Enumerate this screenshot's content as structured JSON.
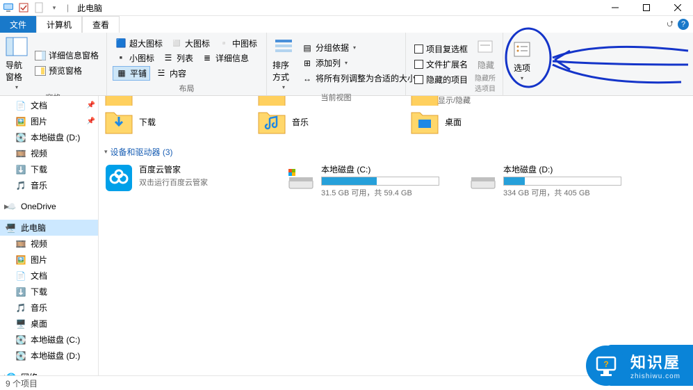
{
  "window": {
    "title": "此电脑",
    "separator": "|"
  },
  "ribbon_tabs": {
    "file": "文件",
    "computer": "计算机",
    "view": "查看"
  },
  "ribbon": {
    "panes": {
      "nav_pane": "导航窗格",
      "detail_pane": "详细信息窗格",
      "preview_pane": "预览窗格",
      "group_label": "窗格"
    },
    "layout": {
      "xl_icons": "超大图标",
      "l_icons": "大图标",
      "m_icons": "中图标",
      "s_icons": "小图标",
      "list": "列表",
      "details": "详细信息",
      "tiles": "平铺",
      "content": "内容",
      "group_label": "布局"
    },
    "current_view": {
      "sort": "排序方式",
      "group_by": "分组依据",
      "add_column": "添加列",
      "fit_columns": "将所有列调整为合适的大小",
      "group_label": "当前视图"
    },
    "show_hide": {
      "item_checkboxes": "项目复选框",
      "file_ext": "文件扩展名",
      "hidden_items": "隐藏的项目",
      "hide_selected": "隐藏所选项目",
      "hide_btn": "隐藏",
      "group_label": "显示/隐藏"
    },
    "options": "选项"
  },
  "nav": {
    "documents": "文档",
    "pictures": "图片",
    "local_d": "本地磁盘 (D:)",
    "videos": "视频",
    "downloads": "下载",
    "music": "音乐",
    "onedrive": "OneDrive",
    "this_pc": "此电脑",
    "desktop": "桌面",
    "local_c": "本地磁盘 (C:)",
    "network": "网络"
  },
  "content": {
    "folders": {
      "downloads": "下载",
      "music": "音乐",
      "desktop": "桌面"
    },
    "devices_header": "设备和驱动器 (3)",
    "baidu": {
      "title": "百度云管家",
      "sub": "双击运行百度云管家"
    },
    "drive_c": {
      "title": "本地磁盘 (C:)",
      "sub": "31.5 GB 可用，共 59.4 GB",
      "fill": 47
    },
    "drive_d": {
      "title": "本地磁盘 (D:)",
      "sub": "334 GB 可用，共 405 GB",
      "fill": 18
    }
  },
  "statusbar": {
    "items": "9 个项目"
  },
  "badge": {
    "text": "知识屋",
    "url": "zhishiwu.com"
  }
}
